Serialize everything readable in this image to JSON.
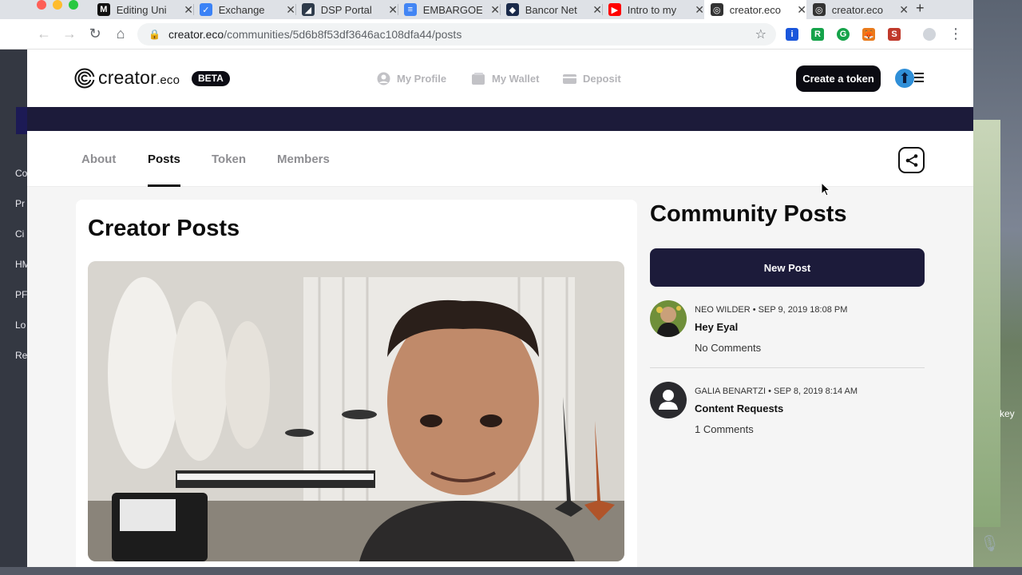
{
  "browser": {
    "tabs": [
      {
        "label": "Editing Uni",
        "favicon": "M",
        "favicon_color": "#111111"
      },
      {
        "label": "Exchange",
        "favicon": "✓",
        "favicon_color": "#3b82f6"
      },
      {
        "label": "DSP Portal",
        "favicon": "◢",
        "favicon_color": "#2d3a4a"
      },
      {
        "label": "EMBARGOE",
        "favicon": "≡",
        "favicon_color": "#4285f4"
      },
      {
        "label": "Bancor Net",
        "favicon": "◆",
        "favicon_color": "#1a2a4a"
      },
      {
        "label": "Intro to my",
        "favicon": "▶",
        "favicon_color": "#ff0000"
      },
      {
        "label": "creator.eco",
        "favicon": "◎",
        "favicon_color": "#333333"
      },
      {
        "label": "creator.eco",
        "favicon": "◎",
        "favicon_color": "#333333"
      }
    ],
    "active_tab": 6,
    "url_host": "creator.eco",
    "url_path": "/communities/5d6b8f53df3646ac108dfa44/posts"
  },
  "desktop": {
    "left_items": [
      "Co",
      "Pr",
      "Ci",
      "HM",
      "PF",
      "Lo",
      "Re"
    ],
    "right_text": "key"
  },
  "header": {
    "logo_main": "creator",
    "logo_suffix": ".eco",
    "beta": "BETA",
    "nav": {
      "profile": "My Profile",
      "wallet": "My Wallet",
      "deposit": "Deposit"
    },
    "create_token": "Create a token"
  },
  "tabs": {
    "about": "About",
    "posts": "Posts",
    "token": "Token",
    "members": "Members",
    "active": "Posts"
  },
  "creator_posts": {
    "title": "Creator Posts"
  },
  "community": {
    "title": "Community Posts",
    "new_post": "New Post",
    "posts": [
      {
        "author": "NEO WILDER",
        "date": "SEP 9, 2019 18:08 PM",
        "title": "Hey Eyal",
        "comments": "No Comments"
      },
      {
        "author": "GALIA BENARTZI",
        "date": "SEP 8, 2019 8:14 AM",
        "title": "Content Requests",
        "comments": "1 Comments"
      }
    ]
  },
  "colors": {
    "banner": "#1c1b3a",
    "primary_button": "#0b0b12",
    "new_post_button": "#1c1b3a",
    "avatar_accent": "#2f8fd8"
  }
}
